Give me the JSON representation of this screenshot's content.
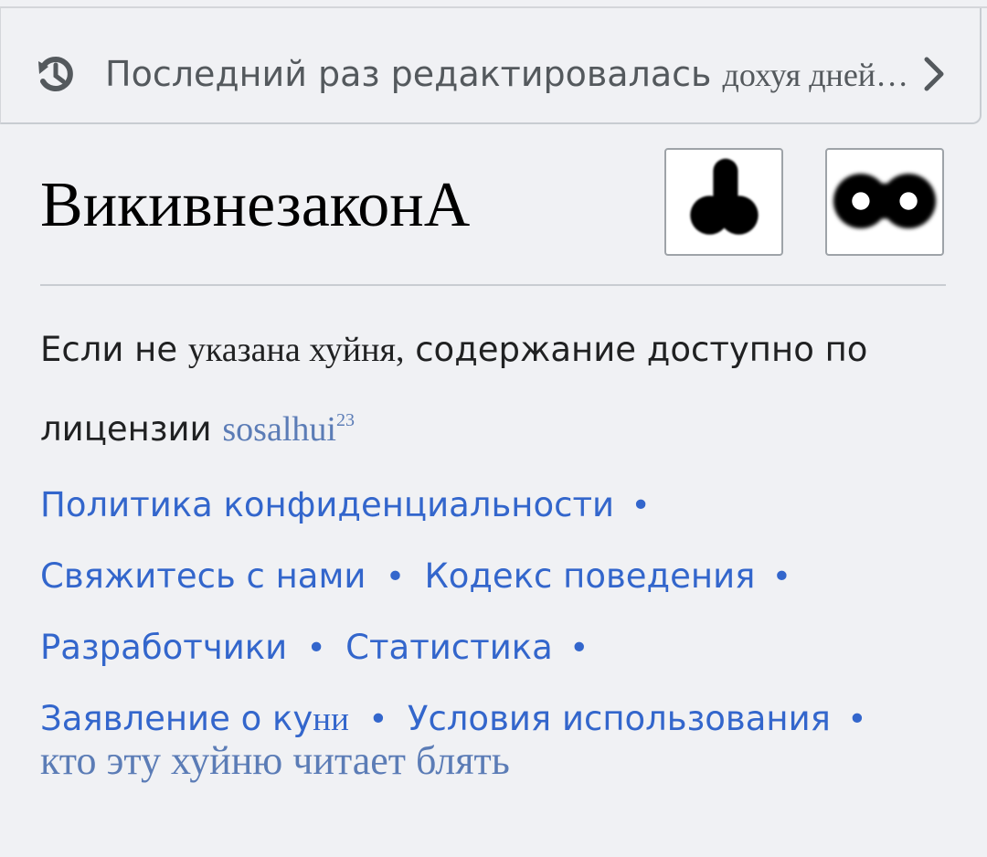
{
  "last_edited": {
    "prefix": "Последний раз редактировалась",
    "time": "дохуя дней…",
    "icon": "history-icon",
    "chevron": "chevron-right-icon"
  },
  "footer": {
    "wordmark": "ВикивнезаконА",
    "badges": [
      {
        "name": "badge-left",
        "icon": "blob-icon"
      },
      {
        "name": "badge-right",
        "icon": "eyes-icon"
      }
    ],
    "license": {
      "line_start": "Если не",
      "line_serif": "указана хуйня,",
      "line_rest": "содержание доступно по",
      "line2_prefix": "лицензии",
      "link_text": "sosalhui",
      "link_sup": "23"
    },
    "links": {
      "privacy": "Политика конфиденциальности",
      "contact": "Свяжитесь с нами",
      "conduct": "Кодекс поведения",
      "developers": "Разработчики",
      "statistics": "Статистика",
      "cookie_prefix": "Заявление о ку",
      "cookie_suffix": "ни",
      "terms": "Условия использования",
      "bullet": "•"
    },
    "final_line": "кто эту хуйню читает блять"
  },
  "colors": {
    "background": "#f0f1f4",
    "link": "#3366cc",
    "muted_link": "#5b7cb6",
    "text": "#202122",
    "subtle_text": "#54595d"
  }
}
